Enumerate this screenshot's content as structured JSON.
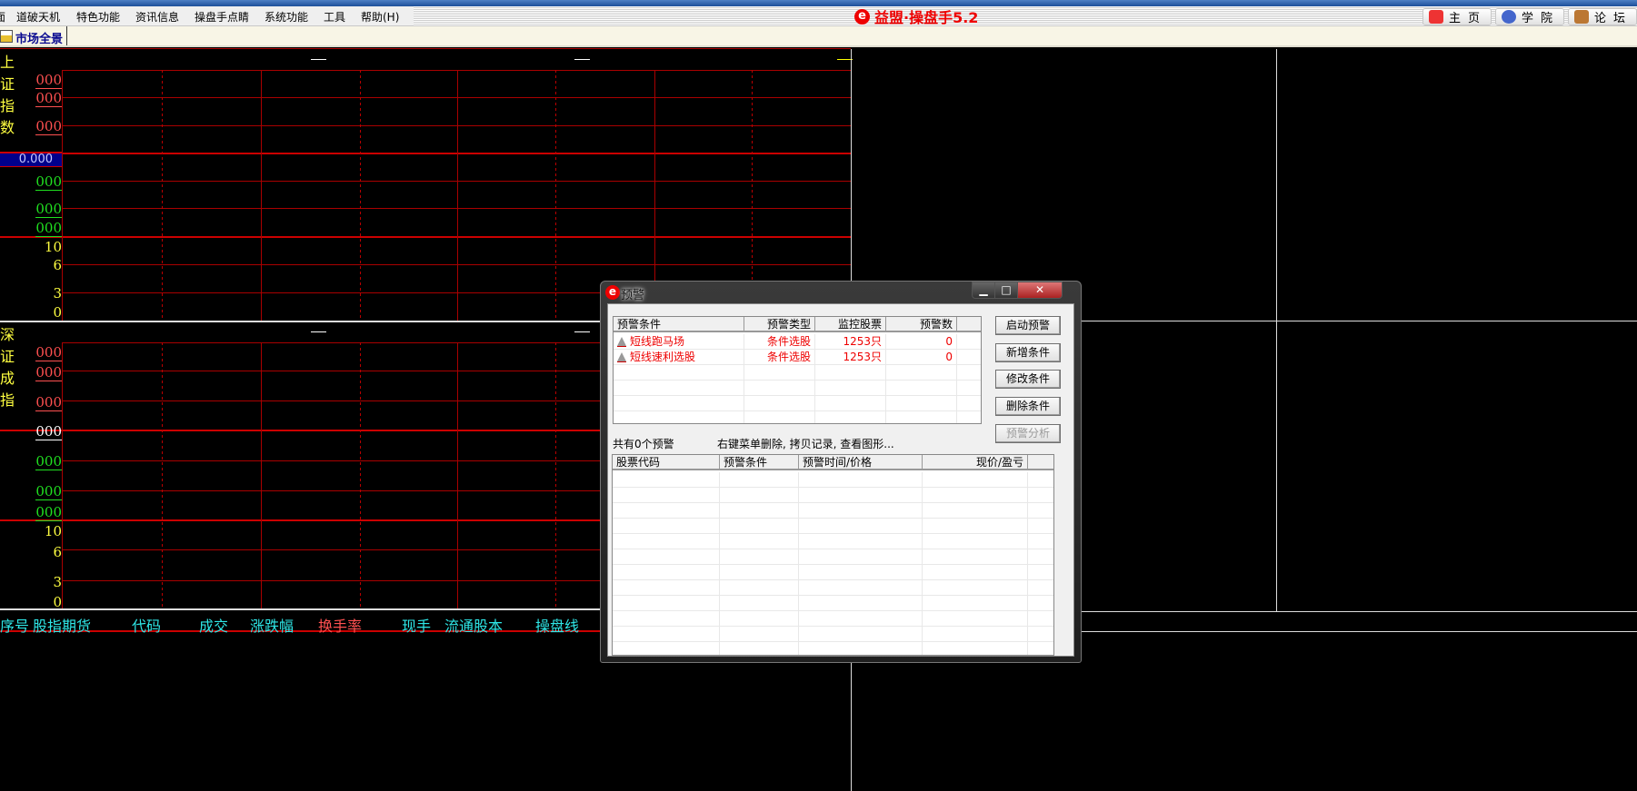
{
  "menu": {
    "items": [
      "面",
      "道破天机",
      "特色功能",
      "资讯信息",
      "操盘手点睛",
      "系统功能",
      "工具",
      "帮助(H)"
    ]
  },
  "brand": {
    "logo_letter": "e",
    "title": "益盟·操盘手5.2"
  },
  "top_buttons": [
    {
      "label": "主页",
      "icon": "home-icon"
    },
    {
      "label": "学院",
      "icon": "academy-icon"
    },
    {
      "label": "论坛",
      "icon": "forum-icon"
    }
  ],
  "toolbar": {
    "market_overview": "市场全景"
  },
  "charts": [
    {
      "title": "上证指数",
      "dash": "—",
      "price_labels": [
        {
          "v": "000",
          "c": "#ff5050"
        },
        {
          "v": "000",
          "c": "#ff5050"
        },
        {
          "v": "000",
          "c": "#ff5050"
        },
        {
          "v": "0.000",
          "c": "#c8c8ff",
          "current": true
        },
        {
          "v": "000",
          "c": "#20e020"
        },
        {
          "v": "000",
          "c": "#20e020"
        },
        {
          "v": "000",
          "c": "#20e020"
        }
      ],
      "volume_labels": [
        "10",
        "6",
        "3",
        "0"
      ]
    },
    {
      "title": "深证成指",
      "dash": "—",
      "price_labels": [
        {
          "v": "000",
          "c": "#ff5050"
        },
        {
          "v": "000",
          "c": "#ff5050"
        },
        {
          "v": "000",
          "c": "#ff5050"
        },
        {
          "v": "000",
          "c": "#ffffff"
        },
        {
          "v": "000",
          "c": "#20e020"
        },
        {
          "v": "000",
          "c": "#20e020"
        },
        {
          "v": "000",
          "c": "#20e020"
        }
      ],
      "volume_labels": [
        "10",
        "6",
        "3",
        "0"
      ]
    }
  ],
  "table_header": [
    {
      "label": "序号",
      "c": "#2ee6e6"
    },
    {
      "label": "股指期货",
      "c": "#2ee6e6"
    },
    {
      "label": "代码",
      "c": "#2ee6e6"
    },
    {
      "label": "成交",
      "c": "#2ee6e6"
    },
    {
      "label": "涨跌幅",
      "c": "#2ee6e6"
    },
    {
      "label": "换手率",
      "c": "#ff5050"
    },
    {
      "label": "现手",
      "c": "#2ee6e6"
    },
    {
      "label": "流通股本",
      "c": "#2ee6e6"
    },
    {
      "label": "操盘线",
      "c": "#2ee6e6"
    }
  ],
  "dialog": {
    "title": "预警",
    "logo_letter": "e",
    "window_buttons": [
      "▁",
      "□",
      "✕"
    ],
    "conditions": {
      "columns": [
        "预警条件",
        "预警类型",
        "监控股票",
        "预警数"
      ],
      "rows": [
        [
          "短线跑马场",
          "条件选股",
          "1253只",
          "0"
        ],
        [
          "短线速利选股",
          "条件选股",
          "1253只",
          "0"
        ]
      ]
    },
    "buttons": [
      {
        "label": "启动预警",
        "enabled": true
      },
      {
        "label": "新增条件",
        "enabled": true
      },
      {
        "label": "修改条件",
        "enabled": true
      },
      {
        "label": "删除条件",
        "enabled": true
      },
      {
        "label": "预警分析",
        "enabled": false
      }
    ],
    "status": "共有0个预警",
    "hint": "右键菜单删除, 拷贝记录, 查看图形...",
    "alerts": {
      "columns": [
        "股票代码",
        "预警条件",
        "预警时间/价格",
        "现价/盈亏"
      ],
      "rows": []
    }
  }
}
